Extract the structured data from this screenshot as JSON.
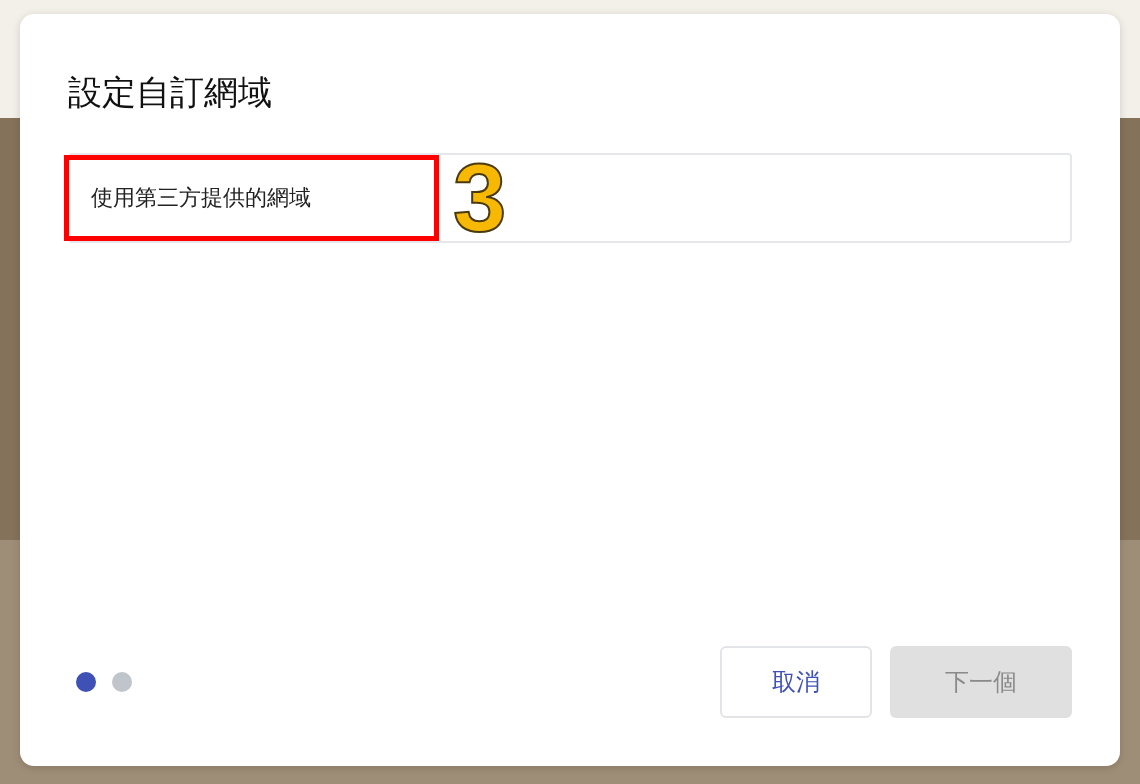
{
  "dialog": {
    "title": "設定自訂網域",
    "options": [
      {
        "label": "使用第三方提供的網域",
        "highlighted": true,
        "annotation": "3"
      }
    ],
    "steps": [
      {
        "selected": true
      },
      {
        "selected": false
      }
    ],
    "buttons": [
      {
        "label": "取消",
        "kind": "secondary",
        "disabled": false
      },
      {
        "label": "下一個",
        "kind": "primary",
        "disabled": true
      }
    ]
  }
}
